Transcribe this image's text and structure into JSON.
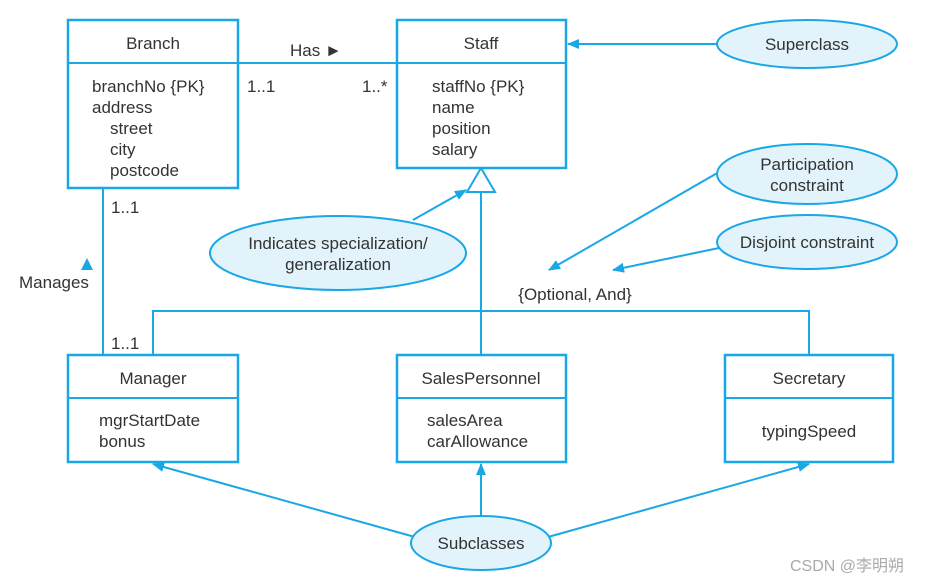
{
  "colors": {
    "line": "#1aa7e6",
    "ellipse_fill": "#e2f3fb"
  },
  "classes": {
    "branch": {
      "name": "Branch",
      "attrs": [
        "branchNo {PK}",
        "address",
        "street",
        "city",
        "postcode"
      ]
    },
    "staff": {
      "name": "Staff",
      "attrs": [
        "staffNo {PK}",
        "name",
        "position",
        "salary"
      ]
    },
    "manager": {
      "name": "Manager",
      "attrs": [
        "mgrStartDate",
        "bonus"
      ]
    },
    "sales": {
      "name": "SalesPersonnel",
      "attrs": [
        "salesArea",
        "carAllowance"
      ]
    },
    "secretary": {
      "name": "Secretary",
      "attrs": [
        "typingSpeed"
      ]
    }
  },
  "relations": {
    "has": {
      "label": "Has ►",
      "mult_left": "1..1",
      "mult_right": "1..*"
    },
    "manages": {
      "label": "Manages",
      "mult_top": "1..1",
      "mult_bottom": "1..1"
    }
  },
  "constraint": "{Optional, And}",
  "notes": {
    "superclass": "Superclass",
    "participation": [
      "Participation",
      "constraint"
    ],
    "disjoint": "Disjoint constraint",
    "specialization": [
      "Indicates specialization/",
      "generalization"
    ],
    "subclasses": "Subclasses"
  },
  "watermark": "CSDN @李明朔"
}
